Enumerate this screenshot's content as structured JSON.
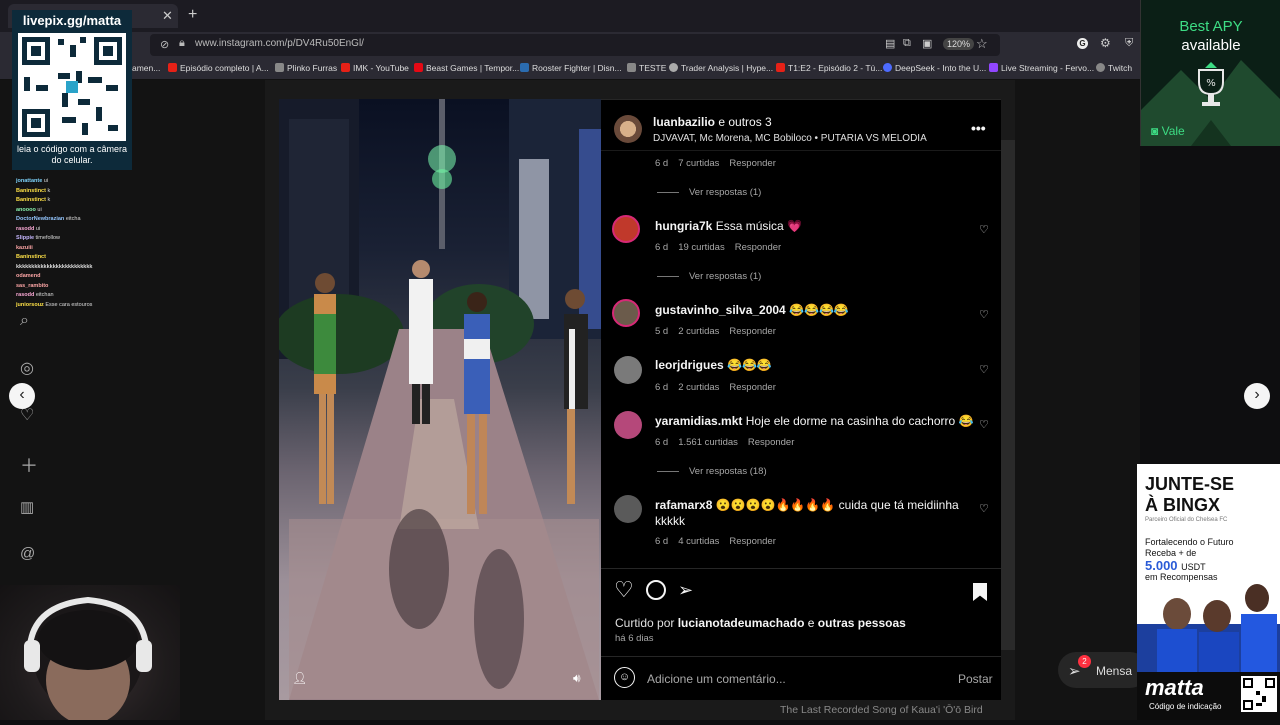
{
  "browser": {
    "url": "www.instagram.com/p/DV4Ru50EnGl/",
    "zoom": "120%",
    "bookmarks": [
      {
        "label": "amen...",
        "color": "#c0392b"
      },
      {
        "label": "Episódio completo | A...",
        "color": "#e62117"
      },
      {
        "label": "Plinko Furras",
        "color": "#888888"
      },
      {
        "label": "IMK - YouTube",
        "color": "#e62117"
      },
      {
        "label": "Beast Games | Tempor...",
        "color": "#e50914"
      },
      {
        "label": "Rooster Fighter | Disn...",
        "color": "#2b6cb0"
      },
      {
        "label": "TESTE",
        "color": "#888888"
      },
      {
        "label": "Trader Analysis | Hype...",
        "color": "#aaaaaa"
      },
      {
        "label": "T1:E2 - Episódio 2 - Tú...",
        "color": "#e62117"
      },
      {
        "label": "DeepSeek - Into the U...",
        "color": "#4d6bfe"
      },
      {
        "label": "Live Streaming - Fervo...",
        "color": "#9146ff"
      },
      {
        "label": "Twitch",
        "color": "#888888"
      }
    ]
  },
  "overlay": {
    "qr_title": "livepix.gg/matta",
    "qr_caption": "leia o código com a câmera do celular.",
    "apy_line1": "Best APY",
    "apy_line2": "available",
    "apy_brand": "Vale",
    "bingx_title1": "JUNTE-SE",
    "bingx_title2": "À BINGX",
    "bingx_sub": "Parceiro Oficial do Chelsea FC",
    "bingx_l1": "Fortalecendo o Futuro",
    "bingx_l2": "Receba + de",
    "bingx_amount": "5.000",
    "bingx_unit": "USDT",
    "bingx_l3": "em Recompensas",
    "matta_brand": "matta",
    "matta_sub": "Código de indicação",
    "song_title": "The Last Recorded Song of Kaua'i 'Ō'ō Bird",
    "messages_label": "Mensa",
    "messages_badge": "2",
    "chat": [
      {
        "user": "jonattante",
        "msg": "ui",
        "color": "#7dd3fc"
      },
      {
        "user": "Baninstinct",
        "msg": "k",
        "color": "#fde047"
      },
      {
        "user": "Baninstinct",
        "msg": "k",
        "color": "#fde047"
      },
      {
        "user": "anoooo",
        "msg": "ui",
        "color": "#86efac"
      },
      {
        "user": "DoctorNewbrazian",
        "msg": "eitcha",
        "color": "#93c5fd"
      },
      {
        "user": "rasodd",
        "msg": "ui",
        "color": "#f9a8d4"
      },
      {
        "user": "Slippie",
        "msg": "timefollow",
        "color": "#c4b5fd"
      },
      {
        "user": "kazuiii",
        "msg": "",
        "color": "#fca5a5"
      },
      {
        "user": "Baninstinct",
        "msg": "",
        "color": "#fde047"
      },
      {
        "user": "kkkkkkkkkkkkkkkkkkkkkkkkk",
        "msg": "",
        "color": "#dddddd"
      },
      {
        "user": "odamend",
        "msg": "",
        "color": "#fca5a5"
      },
      {
        "user": "sas_rambito",
        "msg": "",
        "color": "#fca5a5"
      },
      {
        "user": "rasodd",
        "msg": "eitchan",
        "color": "#f9a8d4"
      },
      {
        "user": "juniorsouz",
        "msg": "Esse cara estouros",
        "color": "#fde047"
      }
    ]
  },
  "post": {
    "author": "luanbazilio",
    "coauthors": "e outros 3",
    "audio": "DJVAVAT, Mc Morena, MC Bobiloco • PUTARIA VS MELODIA",
    "first_meta": {
      "age": "6 d",
      "likes": "7 curtidas",
      "reply": "Responder"
    },
    "first_replies": "Ver respostas (1)",
    "comments": [
      {
        "user": "hungria7k",
        "text": "Essa música 💗",
        "age": "6 d",
        "likes": "19 curtidas",
        "reply": "Responder",
        "replies": "Ver respostas (1)",
        "avatar": "#c0392b"
      },
      {
        "user": "gustavinho_silva_2004",
        "text": "😂😂😂😂",
        "age": "5 d",
        "likes": "2 curtidas",
        "reply": "Responder",
        "replies": "",
        "avatar": "#6b5b4b"
      },
      {
        "user": "leorjdrigues",
        "text": "😂😂😂",
        "age": "6 d",
        "likes": "2 curtidas",
        "reply": "Responder",
        "replies": "",
        "avatar": "#7a7a7a"
      },
      {
        "user": "yaramidias.mkt",
        "text": "Hoje ele dorme na casinha do cachorro 😂",
        "age": "6 d",
        "likes": "1.561 curtidas",
        "reply": "Responder",
        "replies": "Ver respostas (18)",
        "avatar": "#b5487a"
      },
      {
        "user": "rafamarx8",
        "text": "😮😮😮😮🔥🔥🔥🔥 cuida que tá meidiinha",
        "text2": "kkkkk",
        "age": "6 d",
        "likes": "4 curtidas",
        "reply": "Responder",
        "replies": "",
        "avatar": "#5a5a5a"
      }
    ],
    "liked_by_prefix": "Curtido por",
    "liked_by_user": "lucianotadeumachado",
    "liked_by_and": "e",
    "liked_by_rest": "outras pessoas",
    "posted_ago": "há 6 dias",
    "comment_placeholder": "Adicione um comentário...",
    "post_button": "Postar"
  }
}
